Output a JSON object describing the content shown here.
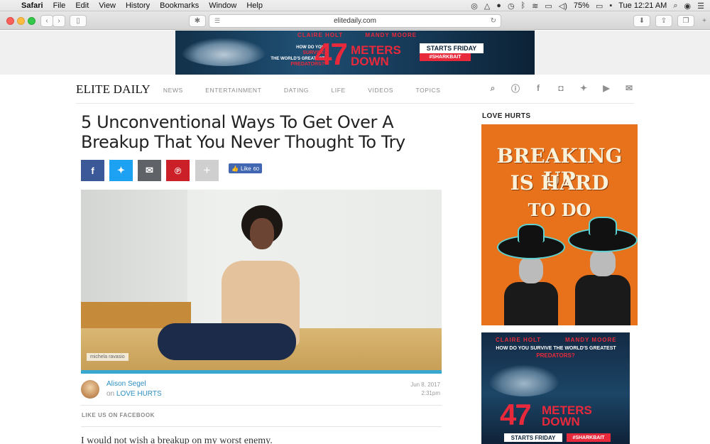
{
  "menubar": {
    "apple": "",
    "items": [
      "Safari",
      "File",
      "Edit",
      "View",
      "History",
      "Bookmarks",
      "Window",
      "Help"
    ],
    "battery": "75%",
    "clock": "Tue 12:21 AM"
  },
  "browser": {
    "url": "elitedaily.com"
  },
  "top_banner": {
    "actor1": "CLAIRE HOLT",
    "actor2": "MANDY MOORE",
    "how": "HOW DO YOU",
    "survive": "SURVIVE",
    "greatest": "THE WORLD'S GREATEST",
    "predators": "PREDATORS?",
    "big_number": "47",
    "title_line1": "METERS",
    "title_line2": "DOWN",
    "starts": "STARTS FRIDAY",
    "hashtag": "#SHARKBAIT"
  },
  "site": {
    "logo": "ELITE DAILY",
    "nav": [
      "NEWS",
      "ENTERTAINMENT",
      "DATING",
      "LIFE",
      "VIDEOS",
      "TOPICS"
    ]
  },
  "article": {
    "headline": "5 Unconventional Ways To Get Over A Breakup That You Never Thought To Try",
    "like_label": "Like",
    "like_count": "60",
    "photo_credit": "michela ravasio",
    "author": "Alison Segel",
    "category_prefix": "on",
    "category": "LOVE HURTS",
    "date": "Jun 8, 2017",
    "time": "2:31pm",
    "like_us": "LIKE US ON FACEBOOK",
    "body_start": "I would not wish a breakup on my worst enemy."
  },
  "sidebar": {
    "heading": "LOVE HURTS",
    "promo_line1": "BREAKING UP",
    "promo_line2": "IS HARD",
    "promo_line3": "TO DO",
    "ad_actor1": "CLAIRE HOLT",
    "ad_actor2": "MANDY MOORE",
    "ad_how": "HOW DO YOU SURVIVE THE WORLD'S GREATEST",
    "ad_predators": "PREDATORS?",
    "ad_big": "47",
    "ad_line1": "METERS",
    "ad_line2": "DOWN",
    "ad_starts": "STARTS FRIDAY",
    "ad_tag": "#SHARKBAIT"
  },
  "colors": {
    "facebook": "#3b5998",
    "twitter": "#1da1f2",
    "email": "#5f6367",
    "pinterest": "#cb2027",
    "link": "#2b8fc1",
    "promo_orange": "#e8721c"
  }
}
